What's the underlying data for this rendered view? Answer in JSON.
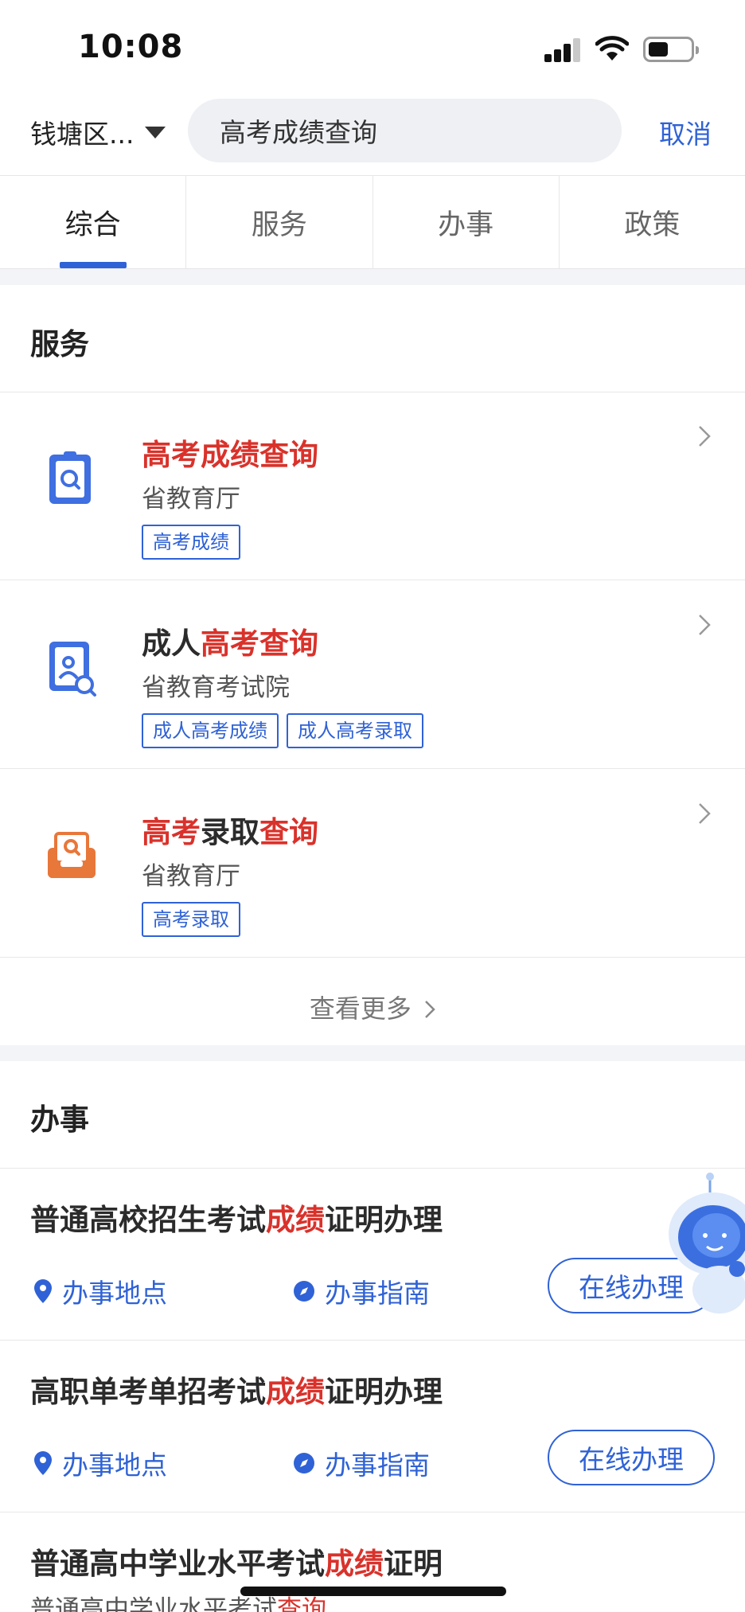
{
  "status_bar": {
    "time": "10:08"
  },
  "search": {
    "region": "钱塘区...",
    "query": "高考成绩查询",
    "cancel_label": "取消"
  },
  "tabs": [
    {
      "label": "综合",
      "active": true
    },
    {
      "label": "服务",
      "active": false
    },
    {
      "label": "办事",
      "active": false
    },
    {
      "label": "政策",
      "active": false
    }
  ],
  "services_section": {
    "title": "服务",
    "items": [
      {
        "title_parts": [
          {
            "t": "高考成绩查询",
            "hl": true
          }
        ],
        "dept": "省教育厅",
        "tags": [
          "高考成绩"
        ],
        "icon": "score-search-icon"
      },
      {
        "title_parts": [
          {
            "t": "成人",
            "hl": false
          },
          {
            "t": "高考查询",
            "hl": true
          }
        ],
        "dept": "省教育考试院",
        "tags": [
          "成人高考成绩",
          "成人高考录取"
        ],
        "icon": "id-card-search-icon"
      },
      {
        "title_parts": [
          {
            "t": "高考",
            "hl": true
          },
          {
            "t": "录取",
            "hl": false
          },
          {
            "t": "查询",
            "hl": true
          }
        ],
        "dept": "省教育厅",
        "tags": [
          "高考录取"
        ],
        "icon": "admission-inbox-icon"
      }
    ],
    "more_label": "查看更多"
  },
  "affairs_section": {
    "title": "办事",
    "items": [
      {
        "title_parts": [
          {
            "t": "普通高校招生考试",
            "hl": false
          },
          {
            "t": "成绩",
            "hl": true
          },
          {
            "t": "证明办理",
            "hl": false
          }
        ]
      },
      {
        "title_parts": [
          {
            "t": "高职单考单招考试",
            "hl": false
          },
          {
            "t": "成绩",
            "hl": true
          },
          {
            "t": "证明办理",
            "hl": false
          }
        ]
      },
      {
        "title_parts": [
          {
            "t": "普通高中学业水平考试",
            "hl": false
          },
          {
            "t": "成绩",
            "hl": true
          },
          {
            "t": "证明",
            "hl": false
          }
        ]
      }
    ],
    "location_label": "办事地点",
    "guide_label": "办事指南",
    "online_label": "在线办理",
    "truncated_line_parts": [
      {
        "t": "普通高中学业水平考试",
        "hl": false
      },
      {
        "t": "查询",
        "hl": true
      }
    ]
  },
  "colors": {
    "accent": "#2f62d6",
    "highlight": "#d9322b",
    "icon_orange": "#e8773a"
  }
}
